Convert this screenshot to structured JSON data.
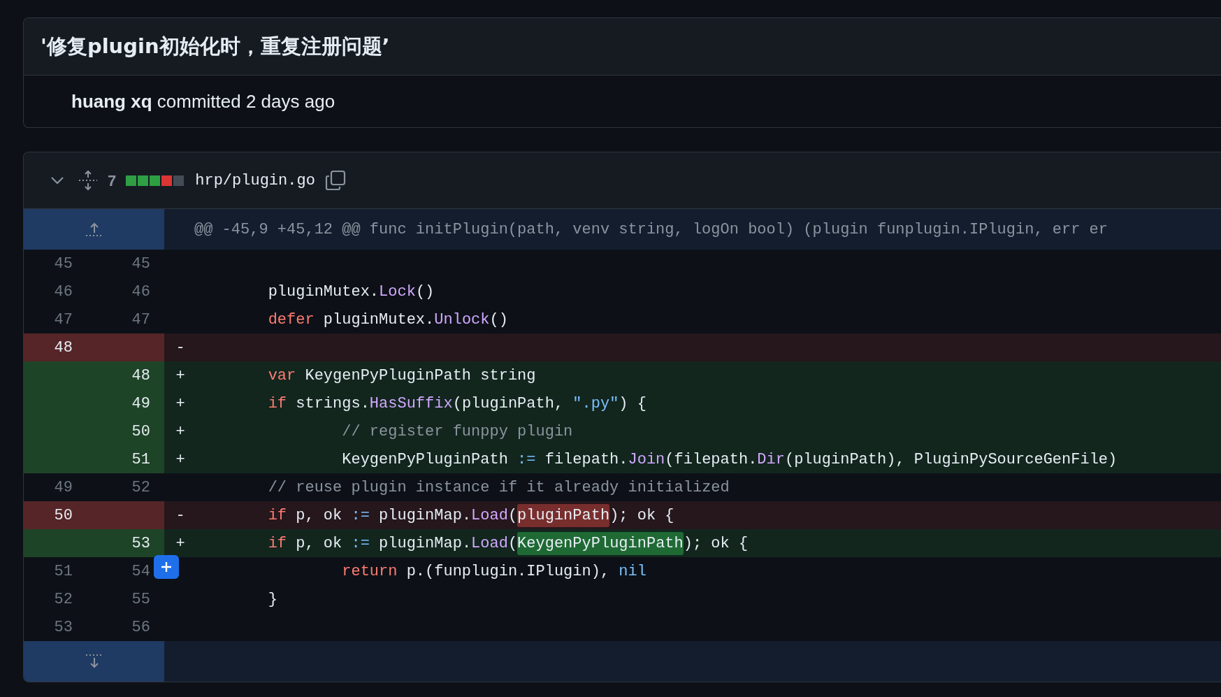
{
  "commit": {
    "title": "'修复plugin初始化时，重复注册问题’",
    "byline": "**huang xq** committed 2 days ago"
  },
  "file": {
    "expanded": true,
    "changes": "7",
    "diffstat": [
      {
        "color": "#2ea043"
      },
      {
        "color": "#2ea043"
      },
      {
        "color": "#2ea043"
      },
      {
        "color": "#da3633"
      },
      {
        "color": "#444c56"
      }
    ],
    "path": "hrp/plugin.go",
    "hunk": "@@ -45,9 +45,12 @@ func initPlugin(path, venv string, logOn bool) (plugin funplugin.IPlugin, err er",
    "lines": [
      {
        "kind": "context",
        "old": "45",
        "new": "45"
      },
      {
        "kind": "context",
        "old": "46",
        "new": "46",
        "code": [
          {
            "kind": "plain",
            "s": "\tpluginMutex."
          },
          {
            "kind": "fn",
            "s": "Lock"
          },
          {
            "kind": "plain",
            "s": "()"
          }
        ]
      },
      {
        "kind": "context",
        "old": "47",
        "new": "47",
        "code": [
          {
            "kind": "kw",
            "s": "\tdefer"
          },
          {
            "kind": "plain",
            "s": " pluginMutex."
          },
          {
            "kind": "fn",
            "s": "Unlock"
          },
          {
            "kind": "plain",
            "s": "()"
          }
        ]
      },
      {
        "kind": "del",
        "old": "48",
        "sign": "-"
      },
      {
        "kind": "add",
        "new": "48",
        "sign": "+",
        "code": [
          {
            "kind": "kw",
            "s": "\tvar"
          },
          {
            "kind": "plain",
            "s": " KeygenPyPluginPath string"
          }
        ]
      },
      {
        "kind": "add",
        "new": "49",
        "sign": "+",
        "code": [
          {
            "kind": "kw",
            "s": "\tif"
          },
          {
            "kind": "plain",
            "s": " strings."
          },
          {
            "kind": "fn",
            "s": "HasSuffix"
          },
          {
            "kind": "plain",
            "s": "(pluginPath, "
          },
          {
            "kind": "str",
            "s": "\".py\""
          },
          {
            "kind": "plain",
            "s": ") {"
          }
        ]
      },
      {
        "kind": "add",
        "new": "50",
        "sign": "+",
        "code": [
          {
            "kind": "cm",
            "s": "\t\t// register funppy plugin"
          }
        ]
      },
      {
        "kind": "add",
        "new": "51",
        "sign": "+",
        "code": [
          {
            "kind": "plain",
            "s": "\t\tKeygenPyPluginPath "
          },
          {
            "kind": "op",
            "s": ":="
          },
          {
            "kind": "plain",
            "s": " filepath."
          },
          {
            "kind": "fn",
            "s": "Join"
          },
          {
            "kind": "plain",
            "s": "(filepath."
          },
          {
            "kind": "fn",
            "s": "Dir"
          },
          {
            "kind": "plain",
            "s": "(pluginPath), PluginPySourceGenFile)"
          }
        ]
      },
      {
        "kind": "context",
        "old": "49",
        "new": "52",
        "code": [
          {
            "kind": "cm",
            "s": "\t// reuse plugin instance if it already initialized"
          }
        ]
      },
      {
        "kind": "del",
        "old": "50",
        "sign": "-",
        "code": [
          {
            "kind": "kw",
            "s": "\tif"
          },
          {
            "kind": "plain",
            "s": " p, ok "
          },
          {
            "kind": "op",
            "s": ":="
          },
          {
            "kind": "plain",
            "s": " pluginMap."
          },
          {
            "kind": "fn",
            "s": "Load"
          },
          {
            "kind": "plain",
            "s": "("
          },
          {
            "kind": "hl",
            "s": "pluginPath"
          },
          {
            "kind": "plain",
            "s": "); ok {"
          }
        ]
      },
      {
        "kind": "add",
        "new": "53",
        "sign": "+",
        "code": [
          {
            "kind": "kw",
            "s": "\tif"
          },
          {
            "kind": "plain",
            "s": " p, ok "
          },
          {
            "kind": "op",
            "s": ":="
          },
          {
            "kind": "plain",
            "s": " pluginMap."
          },
          {
            "kind": "fn",
            "s": "Load"
          },
          {
            "kind": "plain",
            "s": "("
          },
          {
            "kind": "hl",
            "s": "KeygenPyPluginPath"
          },
          {
            "kind": "plain",
            "s": "); ok {"
          }
        ]
      },
      {
        "kind": "context",
        "old": "51",
        "new": "54",
        "comment_button": true,
        "code": [
          {
            "kind": "kw",
            "s": "\t\treturn"
          },
          {
            "kind": "plain",
            "s": " p.(funplugin.IPlugin), "
          },
          {
            "kind": "op",
            "s": "nil"
          }
        ]
      },
      {
        "kind": "context",
        "old": "52",
        "new": "55",
        "code": [
          {
            "kind": "plain",
            "s": "\t}"
          }
        ]
      },
      {
        "kind": "context",
        "old": "53",
        "new": "56"
      }
    ]
  }
}
